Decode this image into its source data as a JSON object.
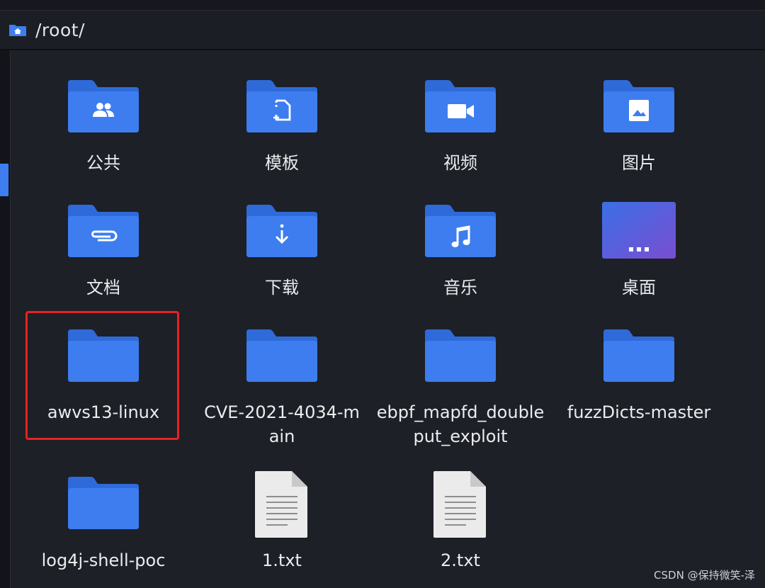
{
  "window": {
    "path": "/root/",
    "home_icon": "home-folder-icon"
  },
  "colors": {
    "background": "#1d2027",
    "folder": "#3d7df0",
    "folder_tab": "#2f6ad9",
    "selection_outline": "#e8231f"
  },
  "files": [
    {
      "label": "公共",
      "kind": "folder",
      "icon": "people-icon"
    },
    {
      "label": "模板",
      "kind": "folder",
      "icon": "template-icon"
    },
    {
      "label": "视频",
      "kind": "folder",
      "icon": "video-camera-icon"
    },
    {
      "label": "图片",
      "kind": "folder",
      "icon": "image-icon"
    },
    {
      "label": "文档",
      "kind": "folder",
      "icon": "paperclip-icon"
    },
    {
      "label": "下载",
      "kind": "folder",
      "icon": "download-icon"
    },
    {
      "label": "音乐",
      "kind": "folder",
      "icon": "music-note-icon"
    },
    {
      "label": "桌面",
      "kind": "desktop",
      "icon": "desktop-icon"
    },
    {
      "label": "awvs13-linux",
      "kind": "folder",
      "icon": "",
      "highlighted": true
    },
    {
      "label": "CVE-2021-4034-main",
      "kind": "folder",
      "icon": ""
    },
    {
      "label": "ebpf_mapfd_doubleput_exploit",
      "kind": "folder",
      "icon": ""
    },
    {
      "label": "fuzzDicts-master",
      "kind": "folder",
      "icon": ""
    },
    {
      "label": "log4j-shell-poc",
      "kind": "folder",
      "icon": ""
    },
    {
      "label": "1.txt",
      "kind": "text-file",
      "icon": "text-file-icon"
    },
    {
      "label": "2.txt",
      "kind": "text-file",
      "icon": "text-file-icon"
    }
  ],
  "watermark": "CSDN @保持微笑-泽"
}
